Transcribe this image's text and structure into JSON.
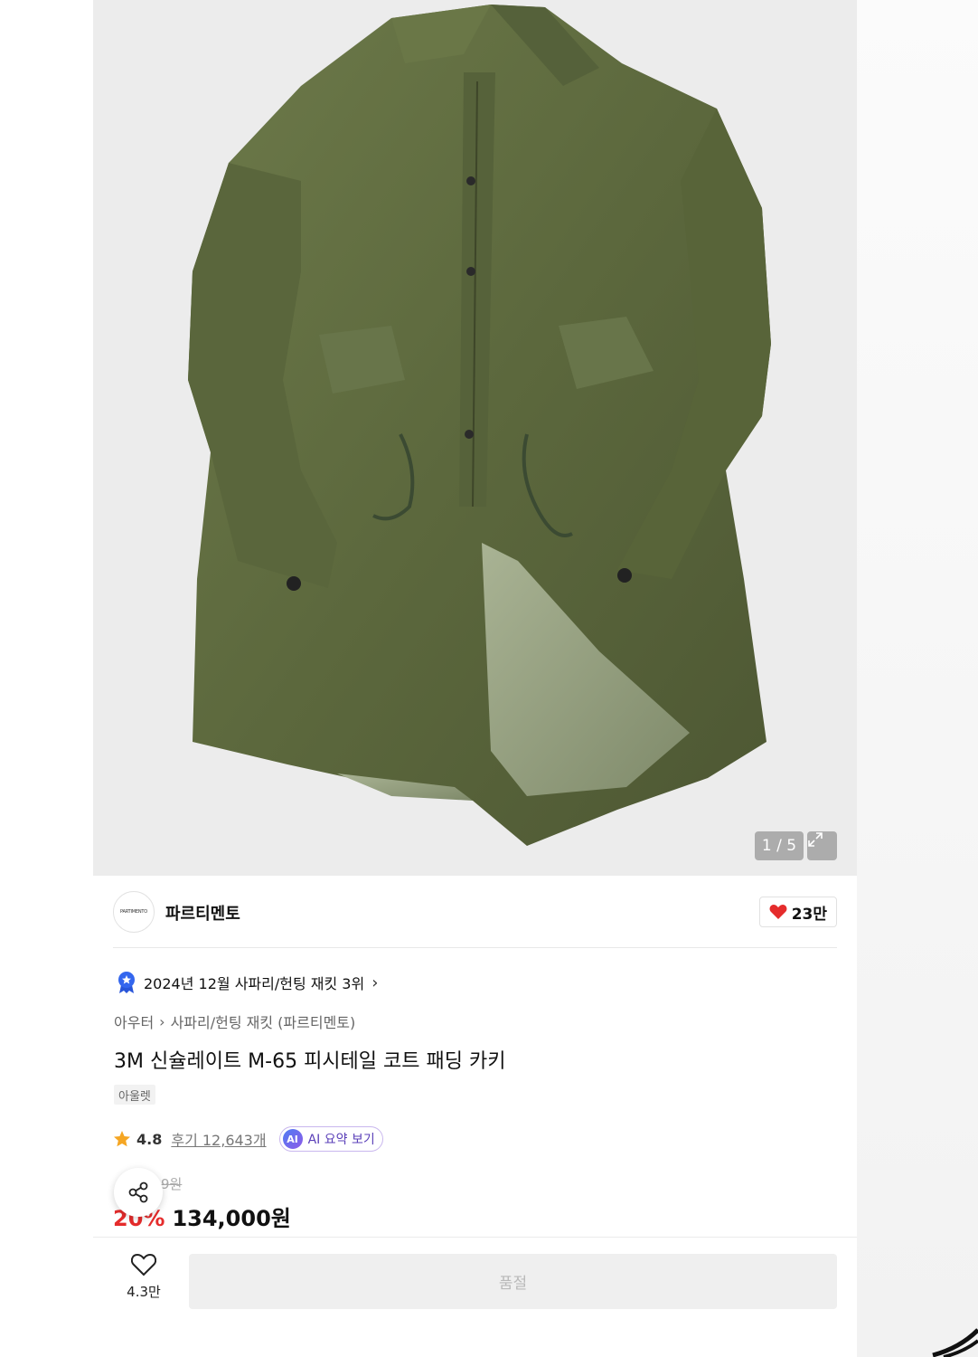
{
  "product_image": {
    "description_icon": "khaki-parka-photo",
    "counter": "1 / 5"
  },
  "brand": {
    "logo_text": "PARTIMENTO",
    "name": "파르티멘토",
    "likes": "23만"
  },
  "ranking": {
    "text": "2024년 12월 사파리/헌팅 재킷 3위"
  },
  "breadcrumb": {
    "level1": "아우터",
    "level2": "사파리/헌팅 재킷 (파르티멘토)"
  },
  "product": {
    "title": "3M 신슐레이트 M-65 피시테일 코트 패딩 카키",
    "tag": "아울렛",
    "rating": "4.8",
    "reviews": "후기 12,643개",
    "ai_summary": "AI 요약 보기",
    "ai_badge": "AI",
    "original_price": "9원",
    "discount": "20%",
    "price": "134,000원"
  },
  "bottom_bar": {
    "wish_count": "4.3만",
    "buy_label": "품절"
  },
  "colors": {
    "like_heart": "#e52c2c",
    "discount": "#e52c2c",
    "coat": "#5f6b3f"
  }
}
